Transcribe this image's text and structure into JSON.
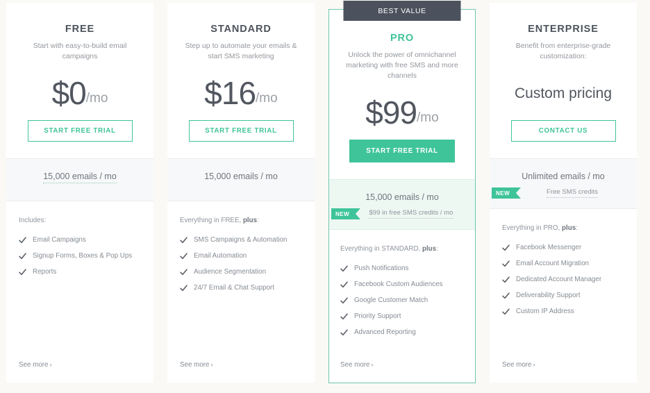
{
  "theme": {
    "page_background": "#faf9f6",
    "accent_green": "#3fc49a",
    "band_gray": "#f7f8f9",
    "band_green": "#eef8f3",
    "tag_dark": "#4b525d",
    "text_dark": "#51565f",
    "text_muted": "#8e949b"
  },
  "plans": [
    {
      "id": "free",
      "name": "FREE",
      "tagline": "Start with easy-to-build email campaigns",
      "price_amount": "$0",
      "price_period": "/mo",
      "cta_label": "START FREE TRIAL",
      "quota_main": "15,000 emails / mo",
      "quota_sub": "",
      "badge_label": "",
      "features_heading_prefix": "Includes:",
      "features_heading_bold": "",
      "features_heading_suffix": "",
      "features": [
        "Email Campaigns",
        "Signup Forms, Boxes & Pop Ups",
        "Reports"
      ],
      "see_more_label": "See more",
      "see_more_chevron": "›"
    },
    {
      "id": "standard",
      "name": "STANDARD",
      "tagline": "Step up to automate your emails & start SMS marketing",
      "price_amount": "$16",
      "price_period": "/mo",
      "cta_label": "START FREE TRIAL",
      "quota_main": "15,000 emails / mo",
      "quota_sub": "",
      "badge_label": "",
      "features_heading_prefix": "Everything in FREE, ",
      "features_heading_bold": "plus",
      "features_heading_suffix": ":",
      "features": [
        "SMS Campaigns & Automation",
        "Email Automation",
        "Audience Segmentation",
        "24/7 Email & Chat Support"
      ],
      "see_more_label": "See more",
      "see_more_chevron": "›"
    },
    {
      "id": "pro",
      "name": "PRO",
      "tagline": "Unlock the power of omnichannel marketing with free SMS and more channels",
      "price_amount": "$99",
      "price_period": "/mo",
      "cta_label": "START FREE TRIAL",
      "quota_main": "15,000 emails / mo",
      "quota_sub": "$99 in free SMS credits / mo",
      "badge_label": "NEW",
      "ribbon_label": "BEST VALUE",
      "features_heading_prefix": "Everything in STANDARD, ",
      "features_heading_bold": "plus",
      "features_heading_suffix": ":",
      "features": [
        "Push Notifications",
        "Facebook Custom Audiences",
        "Google Customer Match",
        "Priority Support",
        "Advanced Reporting"
      ],
      "see_more_label": "See more",
      "see_more_chevron": "›"
    },
    {
      "id": "enterprise",
      "name": "ENTERPRISE",
      "tagline": "Benefit from enterprise-grade customization:",
      "price_amount": "Custom pricing",
      "price_period": "",
      "cta_label": "CONTACT US",
      "quota_main": "Unlimited emails / mo",
      "quota_sub": "Free SMS credits",
      "badge_label": "NEW",
      "features_heading_prefix": "Everything in PRO, ",
      "features_heading_bold": "plus",
      "features_heading_suffix": ":",
      "features": [
        "Facebook Messenger",
        "Email Account Migration",
        "Dedicated Account Manager",
        "Deliverability Support",
        "Custom IP Address"
      ],
      "see_more_label": "See more",
      "see_more_chevron": "›"
    }
  ]
}
